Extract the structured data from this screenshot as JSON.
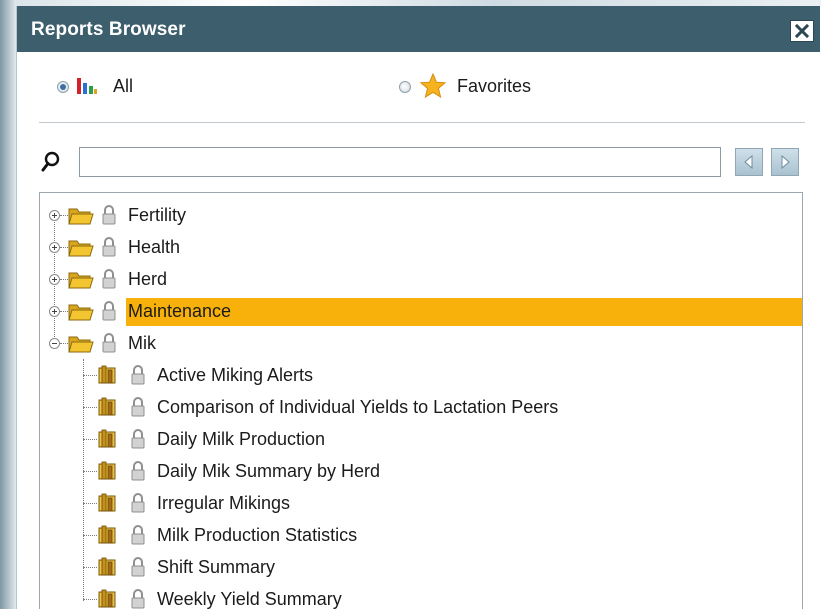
{
  "window": {
    "title": "Reports Browser",
    "close_label": "X"
  },
  "scope": {
    "options": [
      {
        "label": "All",
        "selected": true,
        "icon": "chart-bars-icon"
      },
      {
        "label": "Favorites",
        "selected": false,
        "icon": "star-icon"
      }
    ]
  },
  "search": {
    "value": "",
    "placeholder": ""
  },
  "tree": {
    "folders": [
      {
        "label": "Fertility",
        "expanded": false,
        "selected": false
      },
      {
        "label": "Health",
        "expanded": false,
        "selected": false
      },
      {
        "label": "Herd",
        "expanded": false,
        "selected": false
      },
      {
        "label": "Maintenance",
        "expanded": false,
        "selected": true
      },
      {
        "label": "Mik",
        "expanded": true,
        "selected": false
      }
    ],
    "reports": [
      {
        "label": "Active Miking Alerts"
      },
      {
        "label": "Comparison of Individual Yields to Lactation Peers"
      },
      {
        "label": "Daily Milk Production"
      },
      {
        "label": "Daily Mik Summary by Herd"
      },
      {
        "label": "Irregular Mikings"
      },
      {
        "label": "Milk Production Statistics"
      },
      {
        "label": "Shift Summary"
      },
      {
        "label": "Weekly Yield Summary"
      }
    ]
  },
  "colors": {
    "titlebar": "#3d5e6c",
    "selection": "#f7b10a",
    "folder": "#f2c531",
    "star": "#f4b31f"
  }
}
